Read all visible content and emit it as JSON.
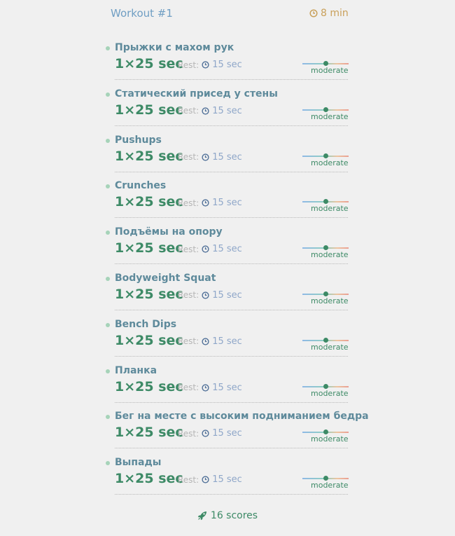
{
  "workout": {
    "title": "Workout #1",
    "duration": "8 min"
  },
  "exercises": [
    {
      "name": "Прыжки с махом рук",
      "sets": "1×25 sec",
      "rest_label": "Rest:",
      "rest_value": "15 sec",
      "intensity": "moderate",
      "intensity_level": 0.5
    },
    {
      "name": "Статический присед у стены",
      "sets": "1×25 sec",
      "rest_label": "Rest:",
      "rest_value": "15 sec",
      "intensity": "moderate",
      "intensity_level": 0.5
    },
    {
      "name": "Pushups",
      "sets": "1×25 sec",
      "rest_label": "Rest:",
      "rest_value": "15 sec",
      "intensity": "moderate",
      "intensity_level": 0.5
    },
    {
      "name": "Crunches",
      "sets": "1×25 sec",
      "rest_label": "Rest:",
      "rest_value": "15 sec",
      "intensity": "moderate",
      "intensity_level": 0.5
    },
    {
      "name": "Подъёмы на опору",
      "sets": "1×25 sec",
      "rest_label": "Rest:",
      "rest_value": "15 sec",
      "intensity": "moderate",
      "intensity_level": 0.5
    },
    {
      "name": "Bodyweight Squat",
      "sets": "1×25 sec",
      "rest_label": "Rest:",
      "rest_value": "15 sec",
      "intensity": "moderate",
      "intensity_level": 0.5
    },
    {
      "name": "Bench Dips",
      "sets": "1×25 sec",
      "rest_label": "Rest:",
      "rest_value": "15 sec",
      "intensity": "moderate",
      "intensity_level": 0.5
    },
    {
      "name": "Планка",
      "sets": "1×25 sec",
      "rest_label": "Rest:",
      "rest_value": "15 sec",
      "intensity": "moderate",
      "intensity_level": 0.5
    },
    {
      "name": "Бег на месте с высоким подниманием бедра",
      "sets": "1×25 sec",
      "rest_label": "Rest:",
      "rest_value": "15 sec",
      "intensity": "moderate",
      "intensity_level": 0.5
    },
    {
      "name": "Выпады",
      "sets": "1×25 sec",
      "rest_label": "Rest:",
      "rest_value": "15 sec",
      "intensity": "moderate",
      "intensity_level": 0.5
    }
  ],
  "footer": {
    "scores": "16 scores"
  },
  "icons": {
    "duration": "clock-icon",
    "rest": "clock-icon",
    "scores": "rocket-icon",
    "bullet": "dot-icon"
  },
  "colors": {
    "title": "#6f9ec3",
    "duration": "#c9a05a",
    "exercise_name": "#5e8a9b",
    "sets": "#3d8a66",
    "rest_value": "#8fa7c9",
    "accent_green": "#3d8a66",
    "bullet": "#a6d3b9",
    "background": "#f0f0f0"
  }
}
